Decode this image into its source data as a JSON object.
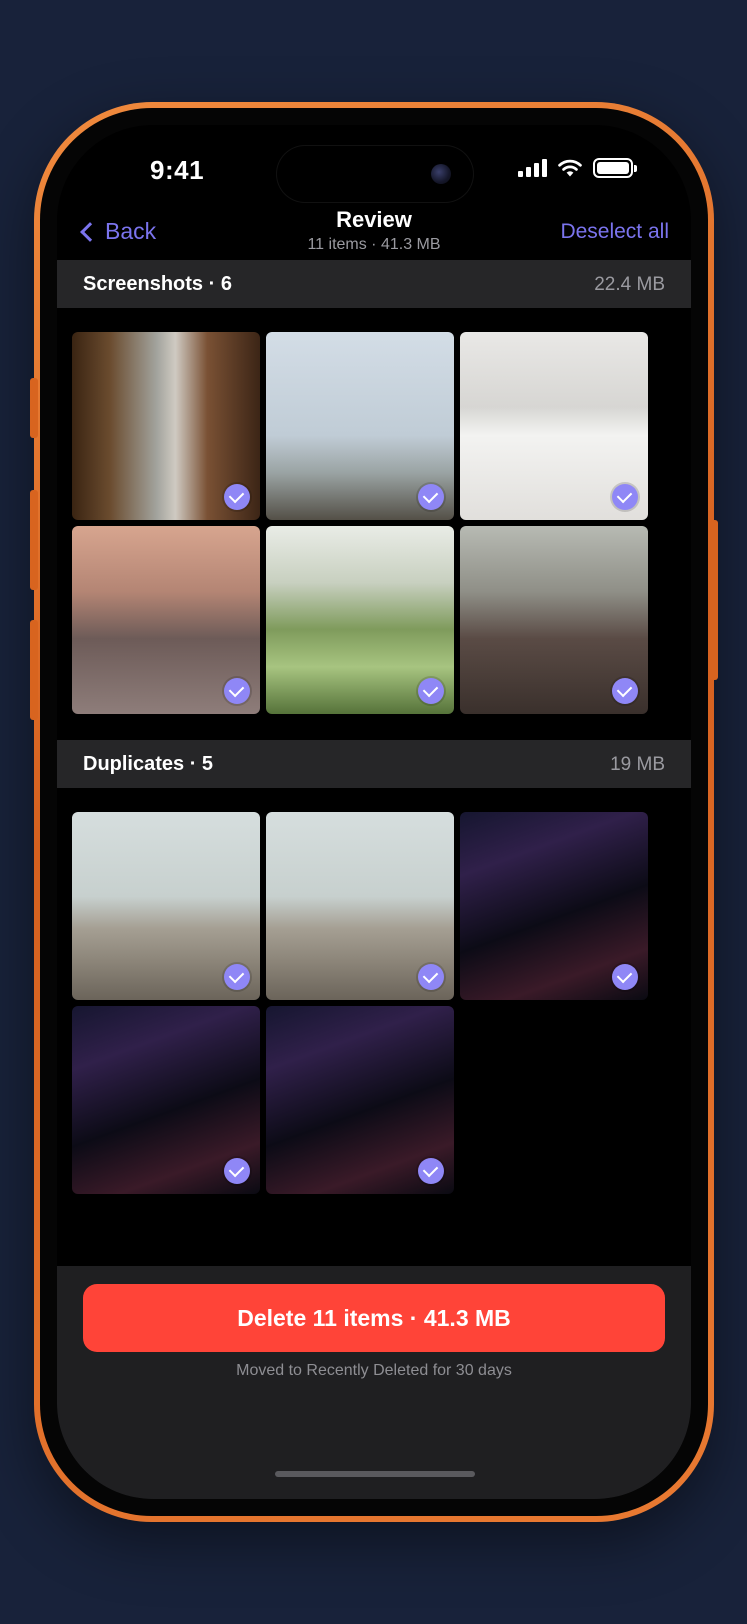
{
  "status": {
    "time": "9:41"
  },
  "nav": {
    "back_label": "Back",
    "title": "Review",
    "subtitle": "11 items · 41.3 MB",
    "deselect_label": "Deselect all"
  },
  "sections": [
    {
      "title": "Screenshots · 6",
      "size": "22.4 MB",
      "items": [
        {
          "photo": "blurred-street",
          "selected": true
        },
        {
          "photo": "group-outdoors",
          "selected": true
        },
        {
          "photo": "white-dog",
          "selected": true
        },
        {
          "photo": "couple-dancing",
          "selected": true
        },
        {
          "photo": "women-laughing",
          "selected": true
        },
        {
          "photo": "party-group",
          "selected": true
        }
      ]
    },
    {
      "title": "Duplicates · 5",
      "size": "19 MB",
      "items": [
        {
          "photo": "rooftop-water-tank",
          "selected": true
        },
        {
          "photo": "rooftop-water-tank",
          "selected": true
        },
        {
          "photo": "nightclub-dancing",
          "selected": true
        },
        {
          "photo": "nightclub-dancing",
          "selected": true
        },
        {
          "photo": "nightclub-dancing",
          "selected": true
        }
      ]
    }
  ],
  "footer": {
    "delete_label": "Delete 11 items · 41.3 MB",
    "hint": "Moved to Recently Deleted for 30 days"
  },
  "colors": {
    "accent": "#7b74ee",
    "check": "#8f87f6",
    "destructive": "#ff4438",
    "frame": "#e97a32",
    "background": "#18223a"
  }
}
